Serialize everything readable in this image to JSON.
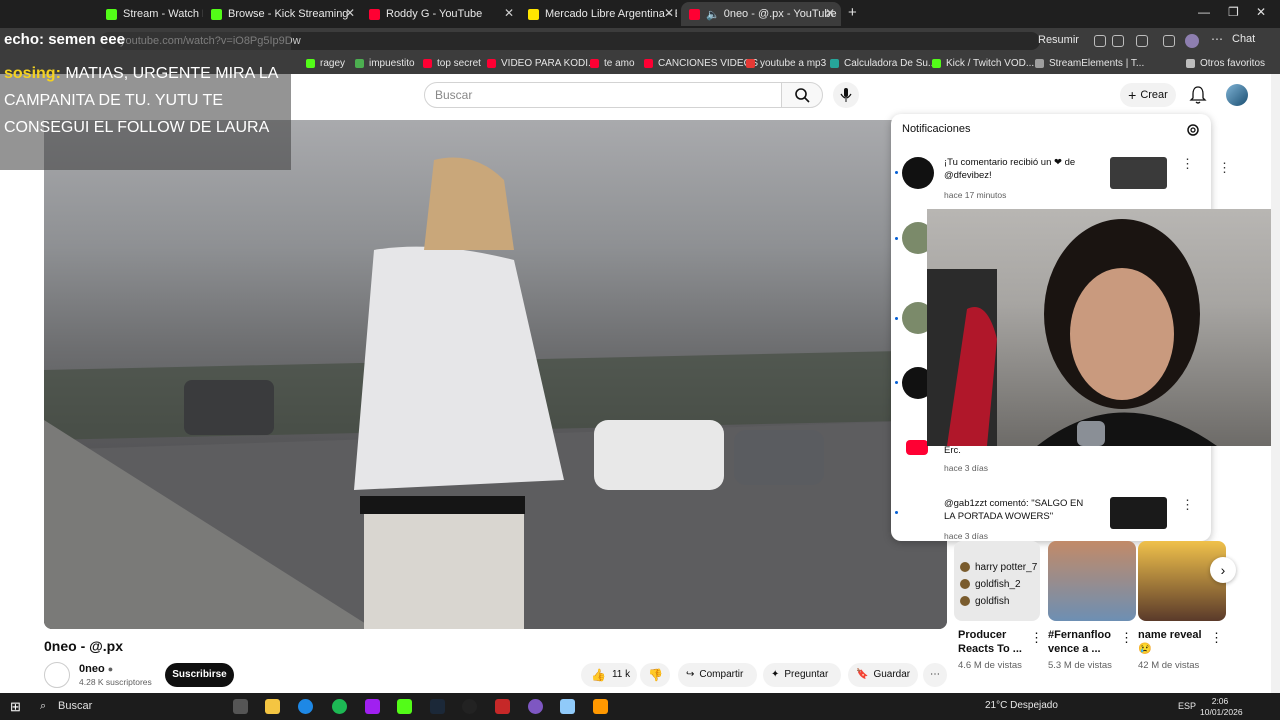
{
  "browser": {
    "tabs": [
      {
        "label": "Stream - Watch Live o",
        "icon_color": "#53fc18"
      },
      {
        "label": "Browse - Kick Streaming",
        "icon_color": "#53fc18"
      },
      {
        "label": "Roddy G - YouTube",
        "icon_color": "#ff0033"
      },
      {
        "label": "Mercado Libre Argentina - Envíos",
        "icon_color": "#ffe600"
      },
      {
        "label": "0neo - @.px - YouTube",
        "icon_color": "#ff0033",
        "active": true
      }
    ],
    "new_tab": "+",
    "url": "youtube.com/watch?v=iO8Pg5Ip9Dw",
    "resumir": "Resumir",
    "chat": "Chat",
    "bookmarks": [
      {
        "label": "ragey",
        "icon_color": "#53fc18"
      },
      {
        "label": "impuestito",
        "icon_color": "#4caf50"
      },
      {
        "label": "top secret",
        "icon_color": "#ff0033"
      },
      {
        "label": "VIDEO PARA KODI...",
        "icon_color": "#ff0033"
      },
      {
        "label": "te amo",
        "icon_color": "#ff0033"
      },
      {
        "label": "CANCIONES VIDEOS",
        "icon_color": "#ff0033"
      },
      {
        "label": "youtube a mp3",
        "icon_color": "#e53935"
      },
      {
        "label": "Calculadora De Su...",
        "icon_color": "#26a69a"
      },
      {
        "label": "Kick / Twitch VOD...",
        "icon_color": "#53fc18"
      },
      {
        "label": "StreamElements | T...",
        "icon_color": "#9e9e9e"
      }
    ],
    "other_bookmarks": "Otros favoritos"
  },
  "overlay": {
    "echo_label": "echo:",
    "echo_text": "semen eee",
    "chat_user": "sosing:",
    "chat_message": "MATIAS, URGENTE MIRA LA CAMPANITA DE TU. YUTU TE CONSEGUI EL FOLLOW DE LAURA"
  },
  "youtube": {
    "search_placeholder": "Buscar",
    "create_label": "Crear",
    "video_title": "0neo - @.px",
    "channel_name": "0neo",
    "channel_subs": "4.28 K suscriptores",
    "subscribe_label": "Suscribirse",
    "likes": "11 k",
    "share_label": "Compartir",
    "ask_label": "Preguntar",
    "save_label": "Guardar"
  },
  "notifications": {
    "title": "Notificaciones",
    "items": [
      {
        "text": "¡Tu comentario recibió un ❤ de @dfevibez!",
        "time": "hace 17 minutos"
      },
      {
        "text": "",
        "time": ""
      },
      {
        "text": "",
        "time": ""
      },
      {
        "text": "",
        "time": ""
      },
      {
        "text": "Erc.",
        "time": "hace 3 días"
      },
      {
        "text": "@gab1zzt comentó: \"SALGO EN LA PORTADA WOWERS\"",
        "time": "hace 3 días"
      }
    ]
  },
  "shorts": [
    {
      "title": "Producer Reacts To ...",
      "views": "4.6 M de vistas"
    },
    {
      "title": "#Fernanfloo vence a ...",
      "views": "5.3 M de vistas"
    },
    {
      "title": "name reveal 😢",
      "views": "42 M de vistas"
    }
  ],
  "short_overlay_names": [
    "harry potter_7",
    "goldfish_2",
    "goldfish"
  ],
  "taskbar": {
    "search": "Buscar",
    "weather": "21°C  Despejado",
    "lang": "ESP",
    "time": "2:06",
    "date": "10/01/2026"
  }
}
